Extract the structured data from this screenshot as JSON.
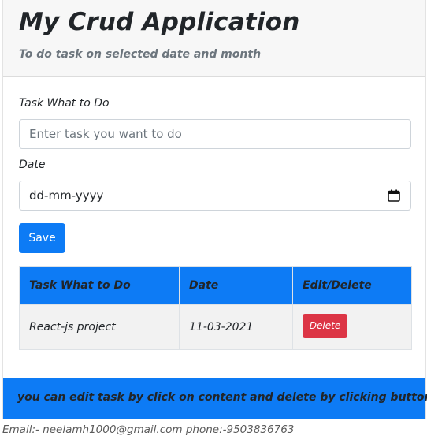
{
  "header": {
    "title": "My Crud Application",
    "subtitle": "To do task on selected date and month"
  },
  "form": {
    "task_label": "Task What to Do",
    "task_placeholder": "Enter task you want to do",
    "task_value": "",
    "date_label": "Date",
    "date_placeholder": "dd-mm-yyyy",
    "save_label": "Save",
    "calendar_icon": "calendar-icon"
  },
  "table": {
    "headers": [
      "Task What to Do",
      "Date",
      "Edit/Delete"
    ],
    "rows": [
      {
        "task": "React-js project",
        "date": "11-03-2021",
        "delete_label": "Delete"
      }
    ]
  },
  "footer": {
    "text": "you can edit task by click on content and delete by clicking button"
  },
  "contact": {
    "text": "Email:- neelamh1000@gmail.com phone:-9503836763"
  },
  "colors": {
    "primary": "#0d7bf5",
    "danger": "#dc3545",
    "header_bg": "#f7f7f7",
    "row_bg": "#f2f2f2",
    "muted": "#6c757d"
  }
}
